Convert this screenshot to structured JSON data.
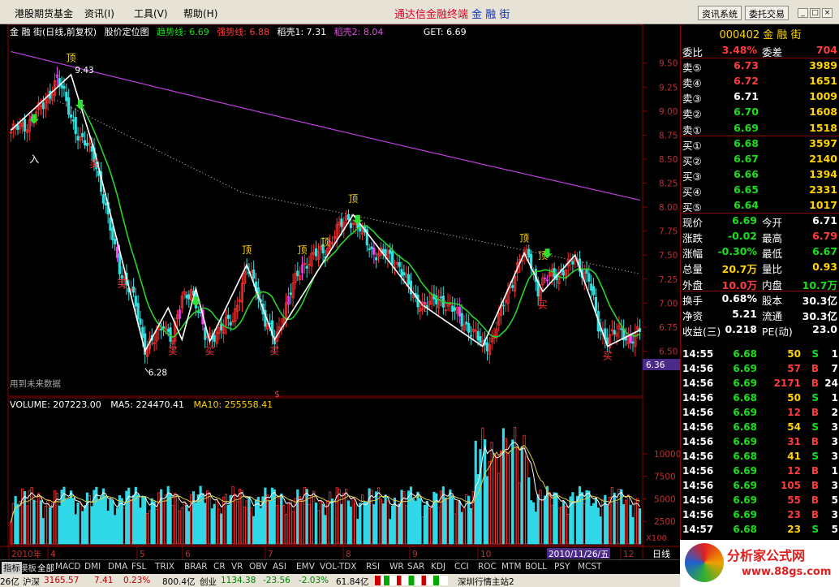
{
  "menu": {
    "items": [
      "港股期货基金",
      "资讯(I)",
      "工具(V)",
      "帮助(H)"
    ],
    "title_red": "通达信金融终端",
    "title_blue": "金 融 街",
    "buttons": [
      "资讯系统",
      "委托交易"
    ],
    "window_controls": [
      "_",
      "□",
      "×"
    ]
  },
  "chart": {
    "stock_name": "金 融 街(日线,前复权)",
    "indicator_name": "股价定位图",
    "trend_label": "趋势线: 6.69",
    "strong_label": "强势线: 6.88",
    "wk1_label": "稻壳1: 7.31",
    "wk2_label": "稻壳2: 8.04",
    "get_label": "GET: 6.69",
    "price_ticks": [
      "9.50",
      "9.25",
      "9.00",
      "8.75",
      "8.50",
      "8.25",
      "8.00",
      "7.75",
      "7.50",
      "7.25",
      "7.00",
      "6.75",
      "6.50"
    ],
    "current_price_tag": "6.36",
    "high_label": "9.43",
    "low_label": "6.28",
    "future_note": "用到未来数据",
    "signal_top": "顶",
    "signal_buy": "买",
    "signal_enter": "入",
    "dollar_mark": "$",
    "colors": {
      "trend": "#ffffff",
      "strong": "#2ad22a",
      "wk1": "#d8d8d8",
      "wk2": "#c040e0",
      "up": "#ff3030",
      "down": "#30e0e0",
      "purple_bar": "#ff40ff",
      "buy_arrow": "#30e030"
    }
  },
  "volume": {
    "label": "VOLUME: 207223.00",
    "ma5": "MA5: 224470.41",
    "ma10": "MA10: 255558.41",
    "ticks": [
      "10000",
      "7500",
      "5000",
      "2500"
    ],
    "unit": "X100"
  },
  "x_axis": {
    "labels": [
      "2010年",
      "4",
      "5",
      "6",
      "7",
      "8",
      "9",
      "10",
      "2010/11/26/五",
      "12"
    ],
    "period": "日线"
  },
  "quote": {
    "title": "000402 金 融 街",
    "rows": [
      {
        "l1": "委比",
        "v1": "3.48%",
        "c1": "red",
        "l2": "委差",
        "v2": "704",
        "c2": "red",
        "bold": true
      },
      {
        "l1": "卖⑤",
        "v1": "6.73",
        "c1": "red",
        "v2": "3989",
        "c2": "yellow"
      },
      {
        "l1": "卖④",
        "v1": "6.72",
        "c1": "red",
        "v2": "1651",
        "c2": "yellow"
      },
      {
        "l1": "卖③",
        "v1": "6.71",
        "c1": "white",
        "v2": "1009",
        "c2": "yellow"
      },
      {
        "l1": "卖②",
        "v1": "6.70",
        "c1": "green",
        "v2": "1608",
        "c2": "yellow"
      },
      {
        "l1": "卖①",
        "v1": "6.69",
        "c1": "green",
        "v2": "1518",
        "c2": "yellow"
      },
      {
        "l1": "买①",
        "v1": "6.68",
        "c1": "green",
        "v2": "3597",
        "c2": "yellow"
      },
      {
        "l1": "买②",
        "v1": "6.67",
        "c1": "green",
        "v2": "2140",
        "c2": "yellow"
      },
      {
        "l1": "买③",
        "v1": "6.66",
        "c1": "green",
        "v2": "1394",
        "c2": "yellow"
      },
      {
        "l1": "买④",
        "v1": "6.65",
        "c1": "green",
        "v2": "2331",
        "c2": "yellow"
      },
      {
        "l1": "买⑤",
        "v1": "6.64",
        "c1": "green",
        "v2": "1017",
        "c2": "yellow"
      },
      {
        "l1": "现价",
        "v1": "6.69",
        "c1": "green",
        "l2": "今开",
        "v2": "6.71",
        "c2": "white"
      },
      {
        "l1": "涨跌",
        "v1": "-0.02",
        "c1": "green",
        "l2": "最高",
        "v2": "6.79",
        "c2": "red"
      },
      {
        "l1": "涨幅",
        "v1": "-0.30%",
        "c1": "green",
        "l2": "最低",
        "v2": "6.67",
        "c2": "green"
      },
      {
        "l1": "总量",
        "v1": "20.7万",
        "c1": "yellow",
        "l2": "量比",
        "v2": "0.93",
        "c2": "yellow"
      },
      {
        "l1": "外盘",
        "v1": "10.0万",
        "c1": "red",
        "l2": "内盘",
        "v2": "10.7万",
        "c2": "green"
      },
      {
        "l1": "换手",
        "v1": "0.68%",
        "c1": "white",
        "l2": "股本",
        "v2": "30.3亿",
        "c2": "white"
      },
      {
        "l1": "净资",
        "v1": "5.21",
        "c1": "white",
        "l2": "流通",
        "v2": "30.3亿",
        "c2": "white"
      },
      {
        "l1": "收益(三)",
        "v1": "0.218",
        "c1": "white",
        "l2": "PE(动)",
        "v2": "23.0",
        "c2": "white"
      }
    ],
    "ticks": [
      {
        "time": "14:55",
        "price": "6.68",
        "vol": "50",
        "bs": "S",
        "n": "1"
      },
      {
        "time": "14:56",
        "price": "6.69",
        "vol": "57",
        "bs": "B",
        "n": "7"
      },
      {
        "time": "14:56",
        "price": "6.69",
        "vol": "2171",
        "bs": "B",
        "n": "24"
      },
      {
        "time": "14:56",
        "price": "6.68",
        "vol": "50",
        "bs": "S",
        "n": "1"
      },
      {
        "time": "14:56",
        "price": "6.69",
        "vol": "12",
        "bs": "B",
        "n": "2"
      },
      {
        "time": "14:56",
        "price": "6.68",
        "vol": "54",
        "bs": "S",
        "n": "3"
      },
      {
        "time": "14:56",
        "price": "6.69",
        "vol": "31",
        "bs": "B",
        "n": "3"
      },
      {
        "time": "14:56",
        "price": "6.68",
        "vol": "41",
        "bs": "S",
        "n": "3"
      },
      {
        "time": "14:56",
        "price": "6.69",
        "vol": "12",
        "bs": "B",
        "n": "1"
      },
      {
        "time": "14:56",
        "price": "6.69",
        "vol": "105",
        "bs": "B",
        "n": "3"
      },
      {
        "time": "14:56",
        "price": "6.69",
        "vol": "55",
        "bs": "B",
        "n": "5"
      },
      {
        "time": "14:56",
        "price": "6.69",
        "vol": "23",
        "bs": "B",
        "n": "3"
      },
      {
        "time": "14:57",
        "price": "6.68",
        "vol": "23",
        "bs": "S",
        "n": "5"
      }
    ]
  },
  "tabs": [
    "指标",
    "模板",
    "全部",
    "MACD",
    "DMI",
    "DMA",
    "FSL",
    "TRIX",
    "BRAR",
    "CR",
    "VR",
    "OBV",
    "ASI",
    "EMV",
    "VOL-TDX",
    "RSI",
    "WR",
    "SAR",
    "KDJ",
    "CCI",
    "ROC",
    "MTM",
    "BOLL",
    "PSY",
    "MCST"
  ],
  "status": {
    "s0": "26亿",
    "s1": "沪深",
    "s2": "3165.57",
    "s3": "7.41",
    "s4": "0.23%",
    "s5": "800.4亿",
    "s6": "创业",
    "s7": "1134.38",
    "s8": "-23.56",
    "s9": "-2.03%",
    "s10": "61.84亿",
    "s11": "深圳行情主站2"
  },
  "watermark": {
    "brand": "分析家公式网",
    "url": "www.88gs.com"
  }
}
